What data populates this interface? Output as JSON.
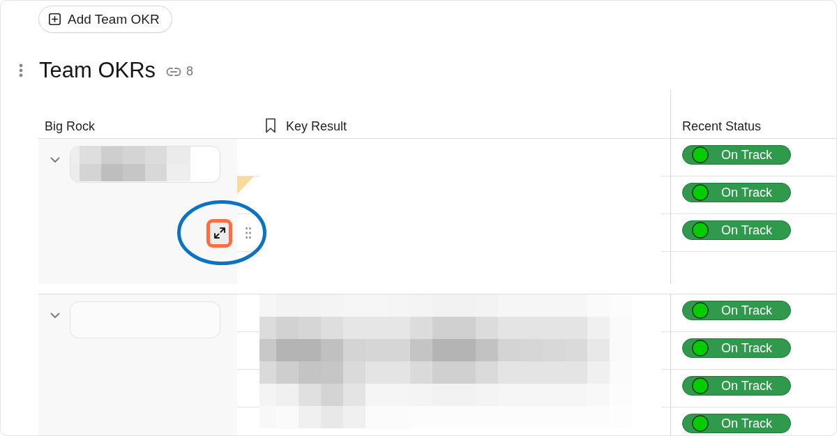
{
  "add_button": {
    "label": "Add Team OKR"
  },
  "section": {
    "title": "Team OKRs",
    "link_count": "8"
  },
  "table": {
    "columns": [
      {
        "label": "Big Rock"
      },
      {
        "label": "Key Result"
      },
      {
        "label": "Recent Status"
      }
    ],
    "groups": [
      {
        "expanded": true,
        "rows": [
          {
            "status": "On Track",
            "corner_flag": false,
            "hovered": false
          },
          {
            "status": "On Track",
            "corner_flag": true,
            "hovered": false
          },
          {
            "status": "On Track",
            "corner_flag": false,
            "hovered": true
          },
          {
            "corner_flag": false,
            "hovered": false
          }
        ]
      },
      {
        "expanded": true,
        "rows": [
          {
            "status": "On Track",
            "corner_flag": false,
            "hovered": false
          },
          {
            "status": "On Track",
            "corner_flag": false,
            "hovered": false
          },
          {
            "status": "On Track",
            "corner_flag": false,
            "hovered": false
          },
          {
            "status": "On Track",
            "corner_flag": false,
            "hovered": false
          }
        ]
      }
    ]
  }
}
